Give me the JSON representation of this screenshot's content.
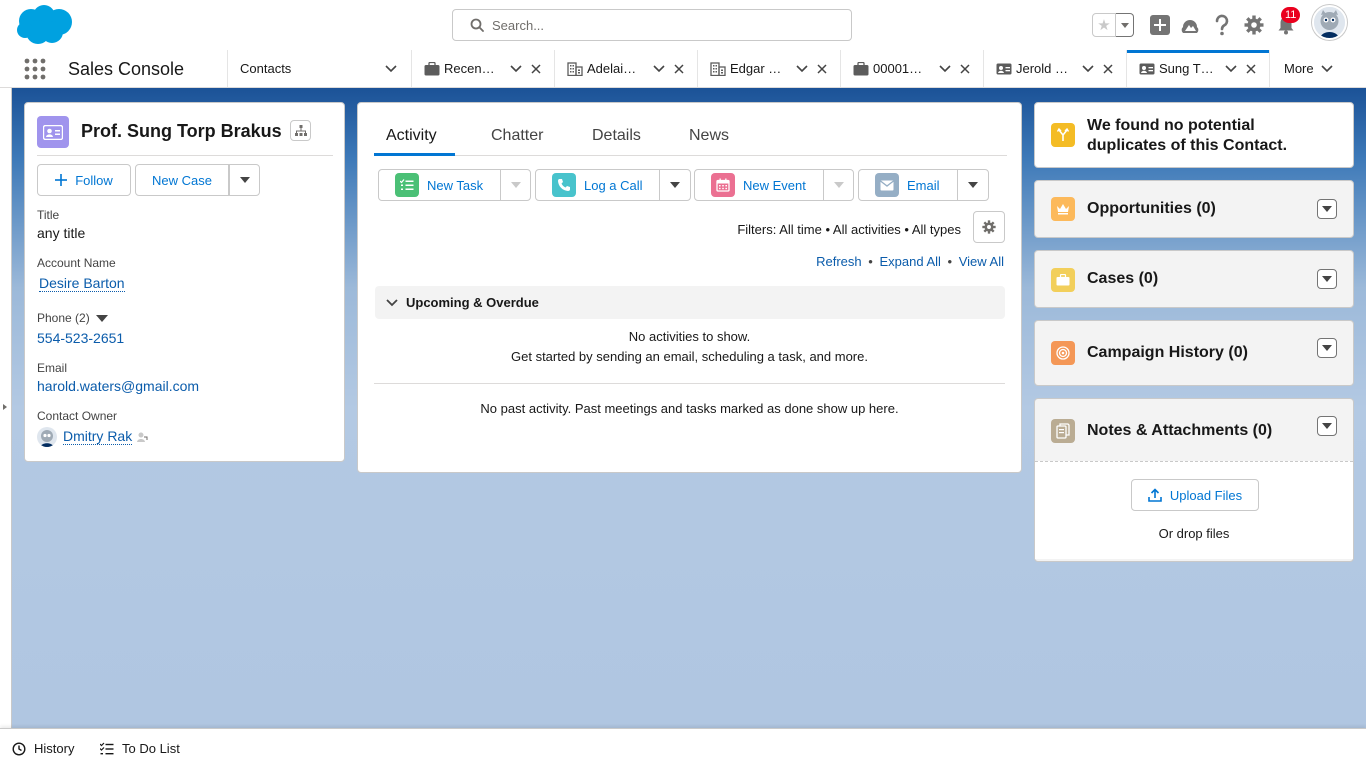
{
  "header": {
    "search_placeholder": "Search...",
    "notification_count": "11"
  },
  "nav": {
    "app_name": "Sales Console",
    "tabs": [
      {
        "label": "Contacts",
        "icon": "none"
      },
      {
        "label": "Recen…",
        "icon": "briefcase-icon"
      },
      {
        "label": "Adelai…",
        "icon": "building-icon"
      },
      {
        "label": "Edgar …",
        "icon": "building-icon"
      },
      {
        "label": "00001…",
        "icon": "briefcase-icon"
      },
      {
        "label": "Jerold …",
        "icon": "contact-card-icon"
      },
      {
        "label": "Sung T…",
        "icon": "contact-card-icon"
      }
    ],
    "more_label": "More"
  },
  "contact": {
    "name": "Prof. Sung Torp Brakus",
    "follow_label": "Follow",
    "new_case_label": "New Case",
    "title_label": "Title",
    "title_value": "any title",
    "account_label": "Account Name",
    "account_value": "Desire Barton",
    "phone_label": "Phone (2)",
    "phone_value": "554-523-2651",
    "email_label": "Email",
    "email_value": "harold.waters@gmail.com",
    "owner_label": "Contact Owner",
    "owner_value": "Dmitry Rak"
  },
  "activity": {
    "tabs": [
      "Activity",
      "Chatter",
      "Details",
      "News"
    ],
    "actions": [
      "New Task",
      "Log a Call",
      "New Event",
      "Email"
    ],
    "filters": "Filters: All time • All activities • All types",
    "refresh": "Refresh",
    "expand_all": "Expand All",
    "view_all": "View All",
    "sep": "•",
    "upcoming_label": "Upcoming & Overdue",
    "no_activities": "No activities to show.",
    "get_started": "Get started by sending an email, scheduling a task, and more.",
    "no_past": "No past activity. Past meetings and tasks marked as done show up here."
  },
  "right": {
    "duplicates": "We found no potential duplicates of this Contact.",
    "opportunities": "Opportunities (0)",
    "cases": "Cases (0)",
    "campaign_history": "Campaign History (0)",
    "notes": "Notes & Attachments (0)",
    "upload_label": "Upload Files",
    "drop_label": "Or drop files"
  },
  "utility": {
    "history": "History",
    "todo": "To Do List"
  },
  "colors": {
    "brand": "#0176d3",
    "contact_icon": "#a094ed",
    "task_icon": "#4bc076",
    "call_icon": "#48c3cc",
    "event_icon": "#eb7092",
    "email_icon": "#95aec5",
    "opportunity_icon": "#fcb95b",
    "case_icon": "#f2cf5b",
    "campaign_icon": "#f49756",
    "notes_icon": "#baac93",
    "badge": "#ea001e"
  }
}
